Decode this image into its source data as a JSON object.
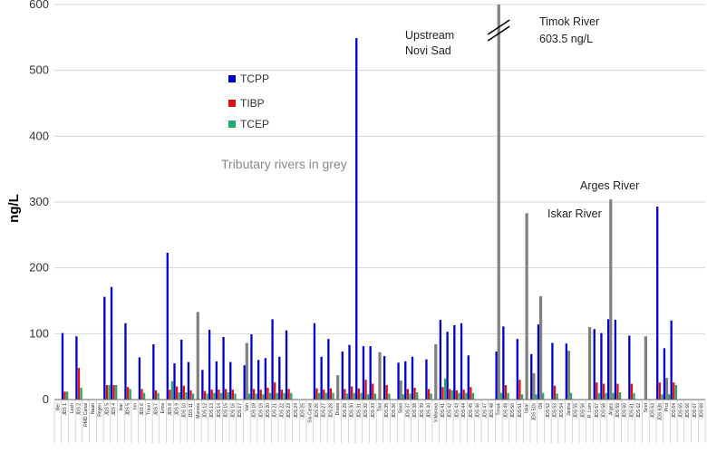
{
  "chart_data": {
    "type": "bar",
    "ylabel": "ng/L",
    "ylim": [
      0,
      600
    ],
    "yticks": [
      0,
      100,
      200,
      300,
      400,
      500,
      600
    ],
    "grid": true,
    "legend": {
      "position": "upper-left",
      "entries": [
        "TCPP",
        "TIBP",
        "TCEP"
      ]
    },
    "colors": {
      "TCPP": "#0000cc",
      "TIBP": "#dd1111",
      "TCEP": "#22aa66",
      "tributary": "#808080"
    },
    "annotations": [
      {
        "text": "Upstream",
        "x_index": 43
      },
      {
        "text": "Novi Sad",
        "x_index": 43
      },
      {
        "text": "Timok River",
        "x_index": 63
      },
      {
        "text": "603.5 ng/L",
        "x_index": 63
      },
      {
        "text": "Iskar River",
        "x_index": 67
      },
      {
        "text": "Arges River",
        "x_index": 79
      },
      {
        "text": "Tributary rivers in grey",
        "x_index": 0
      }
    ],
    "categories": [
      "Iller",
      "JDS 1",
      "Lech",
      "JDS 2",
      "RMD Canal",
      "Naab",
      "Regen",
      "JDS 5",
      "JDS 4",
      "Isar",
      "JDS 5",
      "Inn",
      "JDS 6",
      "Traun",
      "JDS 7",
      "Enns",
      "JDS 8",
      "JDS 9",
      "JDS 10",
      "JDS 11",
      "Morava",
      "JDS 12",
      "JDS 13",
      "JDS 14",
      "JDS 15",
      "JDS 16",
      "JDS 17",
      "Vah",
      "JDS 18",
      "JDS 19",
      "JDS 20",
      "JDS 21",
      "JDS 22",
      "JDS 23",
      "JDS 24",
      "JDS 25",
      "Sio Canal",
      "JDS 26",
      "JDS 27",
      "JDS 28",
      "Drava",
      "JDS 29",
      "JDS 30",
      "JDS 31",
      "JDS 32",
      "JDS 33",
      "Tisa",
      "JDS 35",
      "JDS 36",
      "Sava",
      "JDS 37",
      "JDS 38",
      "JDS 39",
      "JDS 40",
      "V.Morava",
      "JDS 41",
      "JDS 42",
      "JDS 43",
      "JDS 44",
      "JDS 45",
      "JDS 46",
      "JDS 47",
      "JDS 48",
      "Timok",
      "JDS 49",
      "JDS 50",
      "JDS 51",
      "Iskar",
      "JDS 51b",
      "Olt",
      "JDS 52",
      "JDS 53",
      "JDS 54",
      "Jantra",
      "JDS 55",
      "JDS 56",
      "R. Lom",
      "JDS 57",
      "JDS 58",
      "Arges",
      "JDS 59",
      "JDS 60",
      "JDS 61",
      "JDS 62",
      "Siret",
      "JDS 63",
      "JDS 63b",
      "Prut",
      "JDS 64",
      "JDS 65",
      "JDS 66",
      "JDS 67",
      "JDS 68"
    ],
    "series": [
      {
        "name": "TCPP",
        "values": [
          0,
          101,
          0,
          96,
          0,
          0,
          0,
          156,
          171,
          0,
          116,
          0,
          64,
          0,
          84,
          0,
          223,
          55,
          91,
          57,
          0,
          45,
          106,
          58,
          95,
          57,
          0,
          52,
          99,
          60,
          63,
          122,
          65,
          105,
          0,
          0,
          0,
          116,
          65,
          92,
          0,
          73,
          83,
          549,
          81,
          81,
          0,
          66,
          0,
          56,
          58,
          65,
          0,
          61,
          0,
          121,
          103,
          113,
          116,
          67,
          0,
          0,
          0,
          73,
          111,
          0,
          92,
          0,
          69,
          114,
          0,
          86,
          0,
          85,
          0,
          0,
          0,
          107,
          101,
          122,
          121,
          0,
          97,
          0,
          0,
          0,
          293,
          78,
          120,
          0,
          0,
          0,
          0
        ]
      },
      {
        "name": "TIBP",
        "values": [
          0,
          12,
          0,
          48,
          0,
          0,
          0,
          22,
          22,
          0,
          19,
          0,
          16,
          0,
          14,
          0,
          15,
          20,
          21,
          14,
          0,
          13,
          15,
          15,
          16,
          15,
          0,
          14,
          16,
          15,
          18,
          26,
          15,
          16,
          0,
          0,
          0,
          17,
          15,
          17,
          0,
          16,
          20,
          17,
          30,
          24,
          0,
          22,
          0,
          16,
          16,
          18,
          0,
          16,
          0,
          19,
          16,
          14,
          15,
          19,
          0,
          0,
          0,
          18,
          22,
          0,
          30,
          0,
          24,
          22,
          0,
          21,
          0,
          22,
          0,
          0,
          0,
          26,
          24,
          21,
          24,
          0,
          24,
          0,
          0,
          0,
          26,
          27,
          26,
          0,
          0,
          0,
          0
        ]
      },
      {
        "name": "TCEP",
        "values": [
          0,
          12,
          0,
          18,
          0,
          0,
          0,
          22,
          22,
          0,
          16,
          0,
          10,
          0,
          10,
          0,
          28,
          11,
          11,
          9,
          0,
          9,
          10,
          10,
          11,
          9,
          0,
          9,
          9,
          8,
          10,
          10,
          10,
          10,
          0,
          0,
          0,
          10,
          10,
          10,
          0,
          9,
          10,
          10,
          8,
          9,
          0,
          9,
          0,
          8,
          9,
          11,
          0,
          9,
          0,
          32,
          14,
          10,
          10,
          10,
          0,
          0,
          0,
          10,
          10,
          0,
          8,
          0,
          8,
          10,
          0,
          9,
          0,
          10,
          0,
          0,
          0,
          10,
          10,
          10,
          11,
          0,
          10,
          0,
          0,
          0,
          8,
          8,
          22,
          0,
          0,
          0,
          0
        ]
      },
      {
        "name": "Tributaries",
        "values": [
          0,
          0,
          0,
          0,
          0,
          0,
          0,
          0,
          0,
          0,
          0,
          0,
          0,
          0,
          0,
          0,
          0,
          0,
          0,
          0,
          133,
          0,
          0,
          0,
          0,
          0,
          0,
          86,
          0,
          0,
          0,
          0,
          0,
          0,
          0,
          0,
          0,
          0,
          0,
          0,
          37,
          0,
          0,
          0,
          0,
          0,
          72,
          0,
          0,
          29,
          0,
          0,
          0,
          0,
          84,
          0,
          0,
          0,
          0,
          0,
          0,
          0,
          0,
          603.5,
          0,
          0,
          0,
          283,
          40,
          157,
          0,
          0,
          0,
          74,
          0,
          0,
          110,
          0,
          0,
          304,
          0,
          0,
          0,
          0,
          96,
          0,
          0,
          33,
          0,
          0,
          0,
          0,
          0
        ]
      }
    ]
  }
}
